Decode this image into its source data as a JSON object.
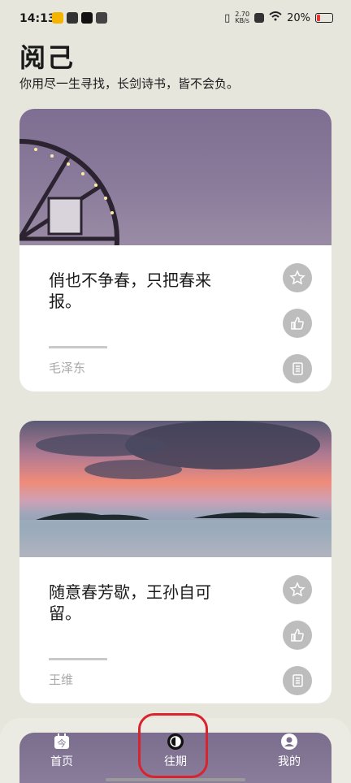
{
  "status_bar": {
    "time": "14:13",
    "net_speed_value": "2.70",
    "net_speed_unit": "KB/s",
    "battery": "20%",
    "battery_level": 0.2
  },
  "header": {
    "title": "阅己",
    "subtitle": "你用尽一生寻找，长剑诗书，皆不会负。"
  },
  "cards": [
    {
      "quote": "俏也不争春，只把春来报。",
      "author": "毛泽东"
    },
    {
      "quote": "随意春芳歇，王孙自可留。",
      "author": "王维"
    }
  ],
  "actions": {
    "favorite_icon": "star-icon",
    "like_icon": "thumbs-up-icon",
    "copy_icon": "document-icon"
  },
  "nav": {
    "home_label": "首页",
    "home_icon_glyph": "今",
    "past_label": "往期",
    "me_label": "我的"
  },
  "colors": {
    "accent_ring": "#d9232e",
    "background": "#e6e6dd",
    "battery_low": "#e53935"
  }
}
